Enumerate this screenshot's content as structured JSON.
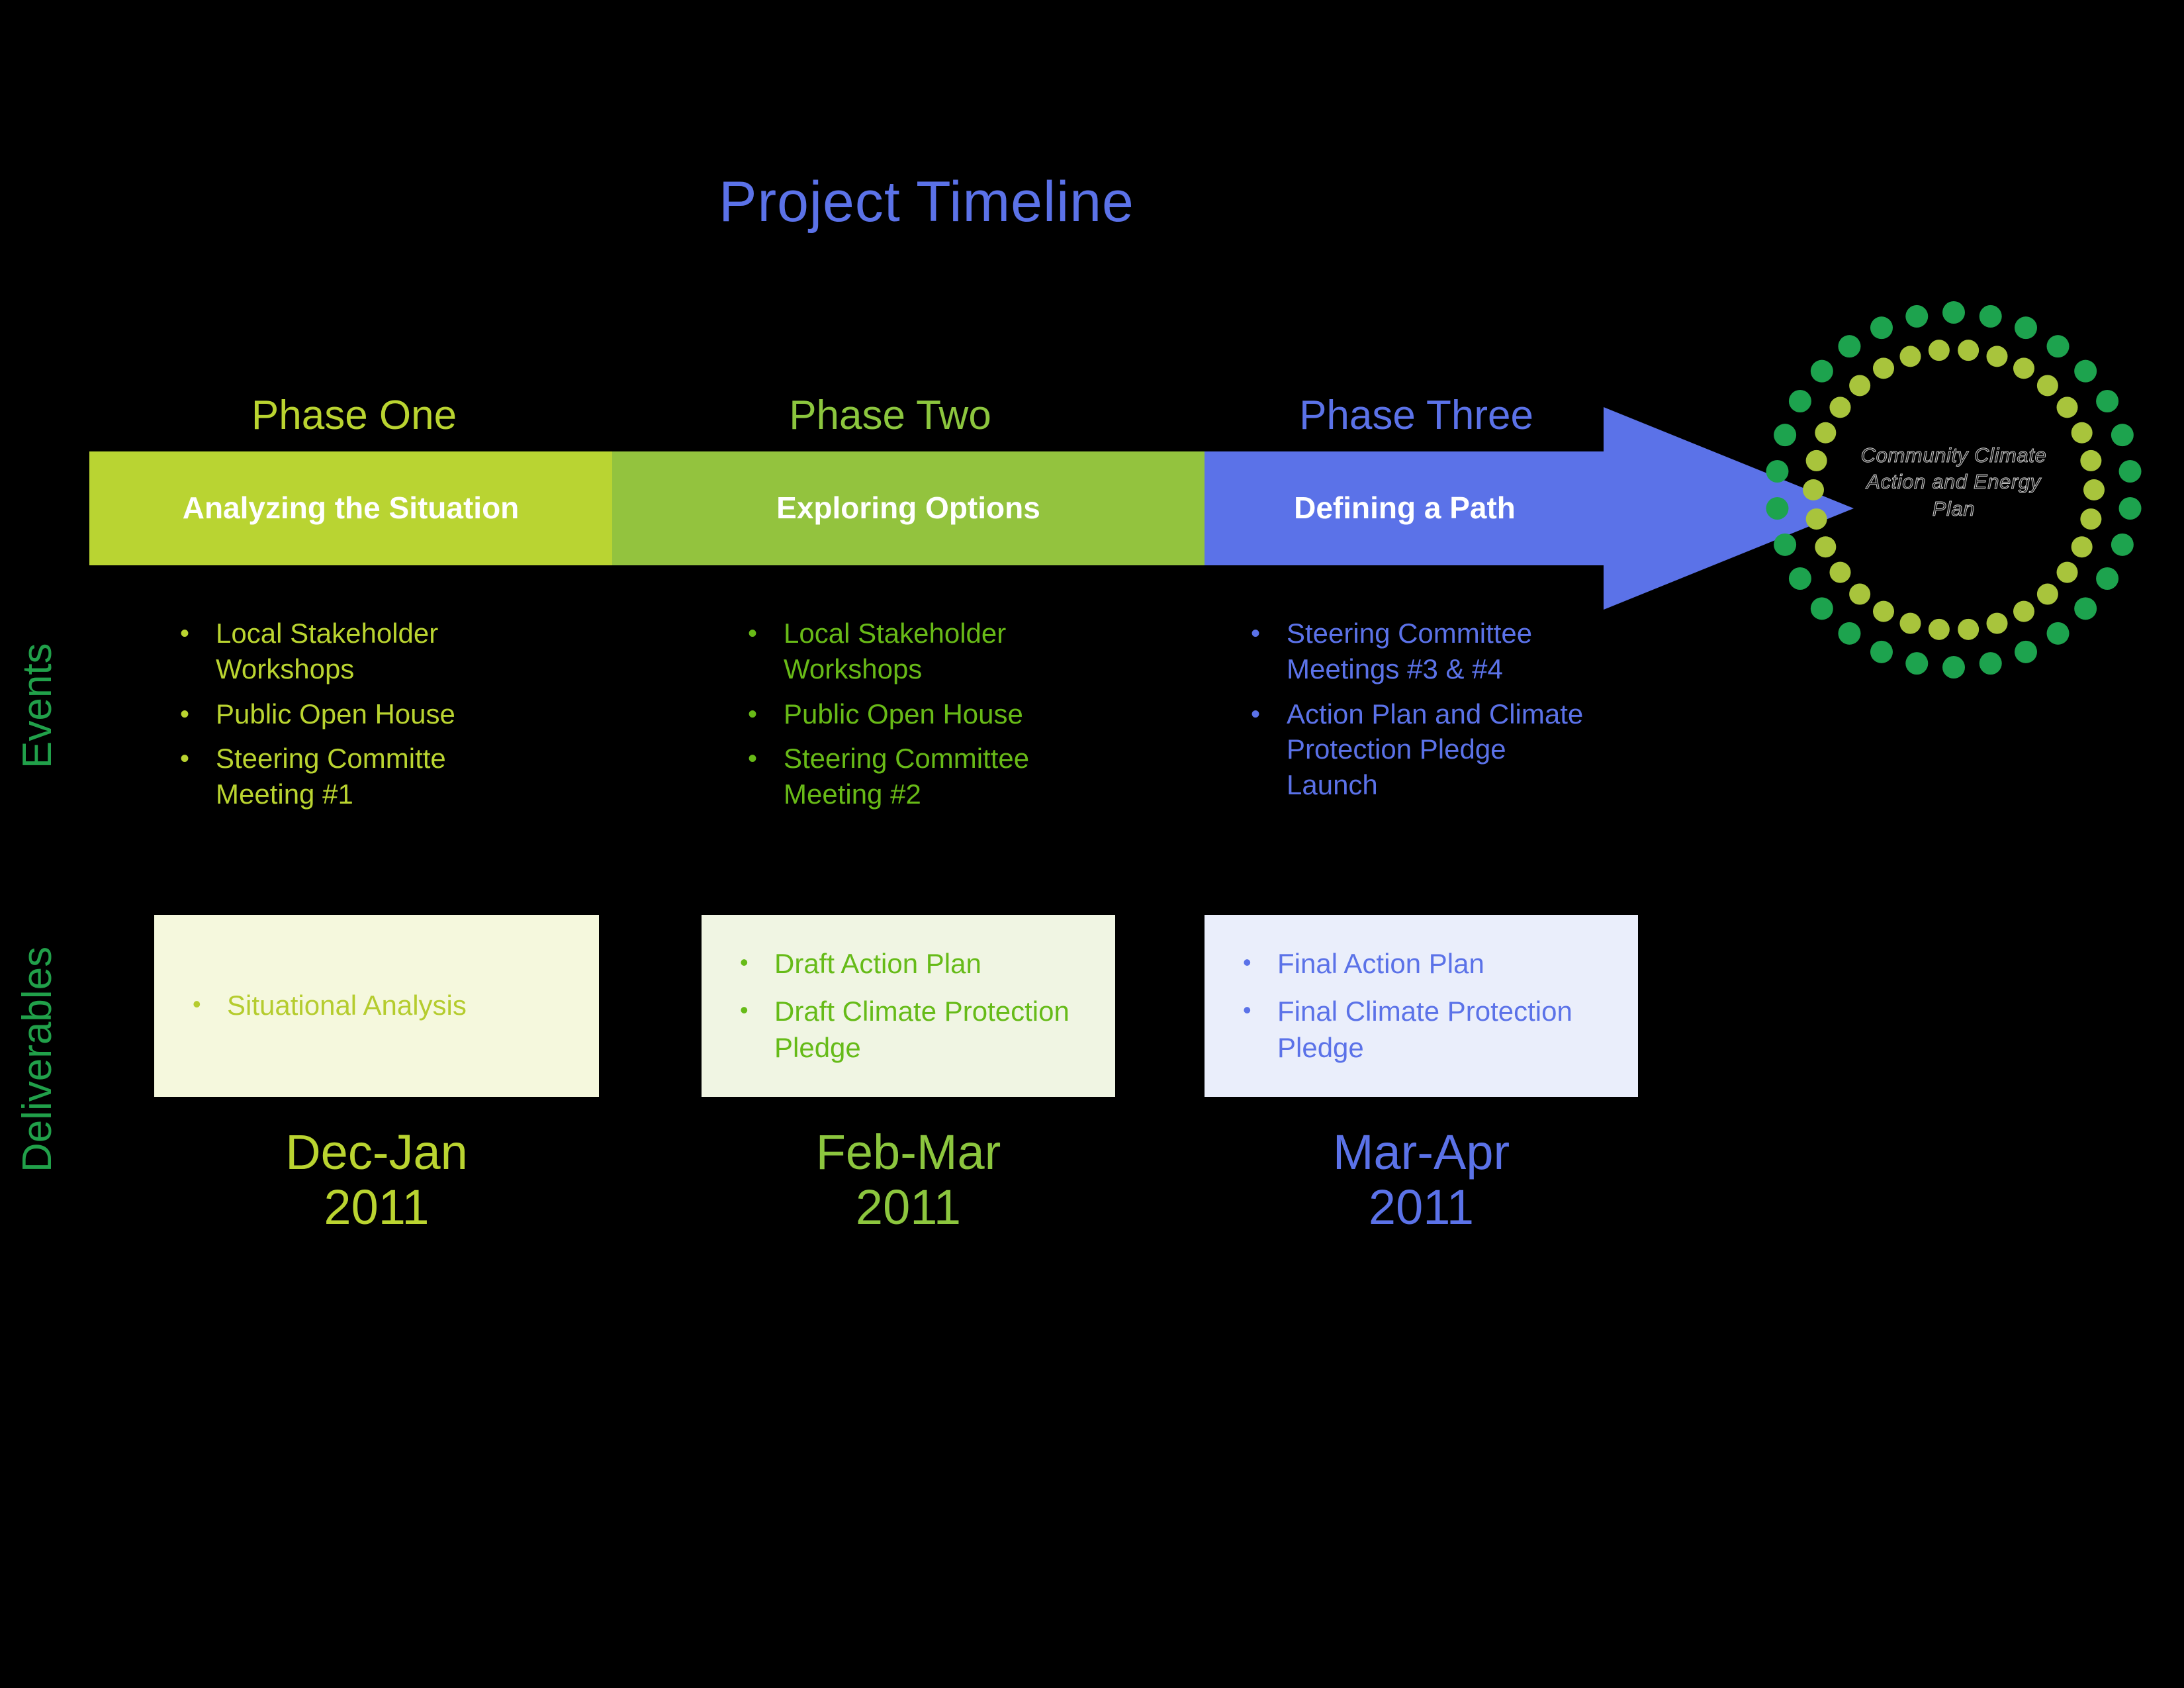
{
  "title": "Project Timeline",
  "axis_labels": {
    "events": "Events",
    "deliverables": "Deliverables"
  },
  "colors": {
    "background": "#000000",
    "title": "#5b72e8",
    "phase_one": "#b9d432",
    "phase_two": "#93c33e",
    "phase_three": "#5b72e8",
    "phase_one_text": "#bad430",
    "phase_two_text": "#68ba17",
    "phase_three_text": "#5b72e8",
    "axis_label": "#21a04a",
    "deliverable_box_one": "#f5f8dd",
    "deliverable_box_two": "#f0f5e3",
    "deliverable_box_three": "#eaeefb",
    "logo_ring_outer": "#1da34e",
    "logo_ring_inner": "#a8c43c"
  },
  "phases": [
    {
      "heading": "Phase One",
      "bar_label": "Analyzing the\nSituation",
      "events": [
        "Local Stakeholder Workshops",
        "Public Open House",
        "Steering Committe Meeting #1"
      ],
      "deliverables": [
        "Situational Analysis"
      ],
      "date": "Dec-Jan\n2011"
    },
    {
      "heading": "Phase Two",
      "bar_label": "Exploring Options",
      "events": [
        "Local Stakeholder Workshops",
        "Public Open House",
        "Steering Committee Meeting #2"
      ],
      "deliverables": [
        "Draft Action Plan",
        "Draft Climate Protection Pledge"
      ],
      "date": "Feb-Mar\n2011"
    },
    {
      "heading": "Phase Three",
      "bar_label": "Defining a\nPath",
      "events": [
        "Steering Committee Meetings #3 & #4",
        "Action Plan and Climate Protection Pledge Launch"
      ],
      "deliverables": [
        "Final Action Plan",
        "Final Climate Protection Pledge"
      ],
      "date": "Mar-Apr\n2011"
    }
  ],
  "bullet_glyph": "•",
  "logo": {
    "center_text": "Community Climate\nAction and Energy\nPlan"
  }
}
